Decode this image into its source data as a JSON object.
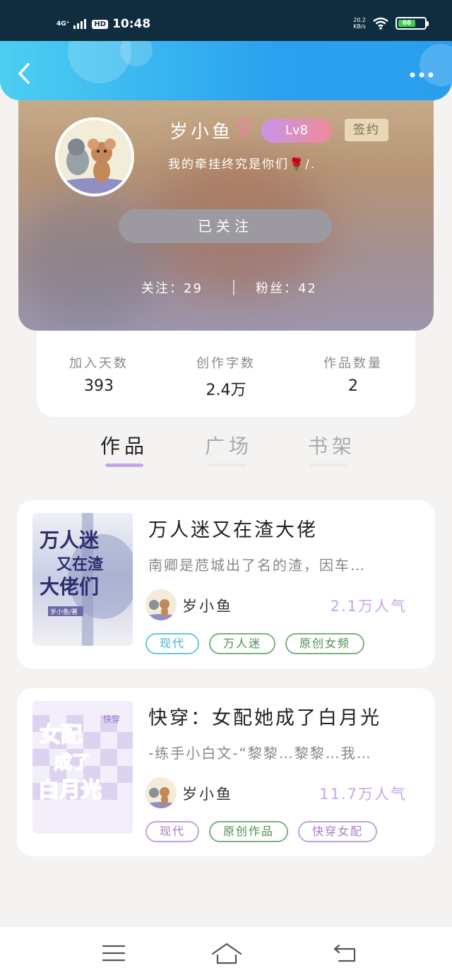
{
  "status_bar": {
    "network": "4G⁺",
    "hd": "HD",
    "time": "10:48",
    "net_speed_value": "20.2",
    "net_speed_unit": "KB/s",
    "battery_level": 66,
    "battery_text": "66",
    "icons": [
      "signal-icon",
      "wifi-icon",
      "battery-icon"
    ]
  },
  "header": {
    "back_icon": "chevron-left-icon",
    "more_icon": "more-dots-icon"
  },
  "profile": {
    "nickname": "岁小鱼",
    "gender_symbol": "♀",
    "level": "Lv8",
    "signed_badge": "签约",
    "motto": "我的牵挂终究是你们🌹/.",
    "follow_button": "已关注",
    "following_label": "关注：",
    "following_count": "29",
    "fans_label": "粉丝：",
    "fans_count": "42"
  },
  "stats": [
    {
      "label": "加入天数",
      "value": "393"
    },
    {
      "label": "创作字数",
      "value": "2.4万"
    },
    {
      "label": "作品数量",
      "value": "2"
    }
  ],
  "tabs": [
    {
      "label": "作品",
      "active": true
    },
    {
      "label": "广场",
      "active": false
    },
    {
      "label": "书架",
      "active": false
    }
  ],
  "books": [
    {
      "title": "万人迷又在渣大佬",
      "description": "南卿是苊城出了名的渣，因车…",
      "author": "岁小鱼",
      "popularity": "2.1万人气",
      "cover_text": [
        "万人迷",
        "又在渣",
        "大佬们",
        "岁小鱼/著"
      ],
      "tags": [
        {
          "label": "现代",
          "color": "#3fb3cd"
        },
        {
          "label": "万人迷",
          "color": "#4e8c54"
        },
        {
          "label": "原创女频",
          "color": "#4e8c54"
        }
      ]
    },
    {
      "title": "快穿：女配她成了白月光",
      "description": "-练手小白文-“黎黎…黎黎…我…",
      "author": "岁小鱼",
      "popularity": "11.7万人气",
      "cover_text": [
        "女配",
        "成了",
        "白月光",
        "快穿"
      ],
      "tags": [
        {
          "label": "现代",
          "color": "#a77cc9"
        },
        {
          "label": "原创作品",
          "color": "#4e8c54"
        },
        {
          "label": "快穿女配",
          "color": "#a77cc9"
        }
      ]
    }
  ],
  "navbar": {
    "icons": [
      "menu-icon",
      "home-icon",
      "back-icon"
    ]
  },
  "colors": {
    "header_start": "#4ccff2",
    "header_end": "#2a9eee",
    "accent_purple": "#c6a6e8",
    "follow_button": "#9c99a1"
  }
}
